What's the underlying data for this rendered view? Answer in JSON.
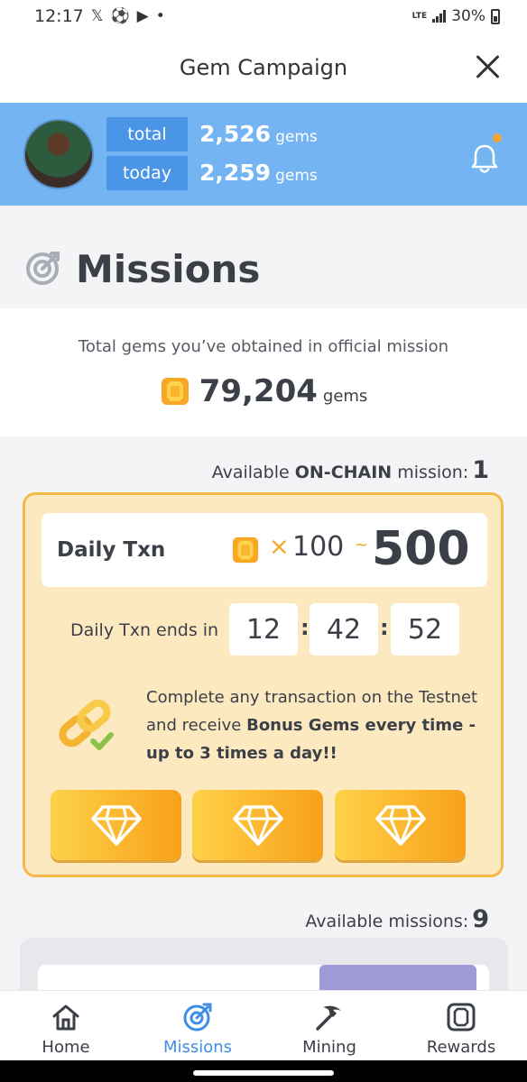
{
  "status_bar": {
    "time": "12:17",
    "network": "LTE",
    "battery": "30%"
  },
  "header": {
    "title": "Gem Campaign"
  },
  "profile": {
    "total_label": "total",
    "total_value": "2,526",
    "today_label": "today",
    "today_value": "2,259",
    "unit": "gems"
  },
  "missions": {
    "title": "Missions",
    "official_label": "Total gems you’ve obtained in official mission",
    "official_value": "79,204",
    "official_unit": "gems"
  },
  "onchain": {
    "prefix": "Available ",
    "bold": "ON-CHAIN",
    "suffix": " mission:",
    "count": "1"
  },
  "daily_txn": {
    "title": "Daily Txn",
    "multiplier": "×",
    "min": "100",
    "tilde": "~",
    "max": "500",
    "ends_label": "Daily Txn ends in",
    "timer": {
      "hours": "12",
      "minutes": "42",
      "seconds": "52"
    },
    "desc_part1": "Complete any transaction on the Testnet and receive ",
    "desc_bold": "Bonus Gems every time - up to 3 times a day!!"
  },
  "available_missions": {
    "label": "Available missions:",
    "count": "9"
  },
  "nav": [
    {
      "label": "Home"
    },
    {
      "label": "Missions"
    },
    {
      "label": "Mining"
    },
    {
      "label": "Rewards"
    }
  ],
  "colors": {
    "accent": "#74b4f2",
    "tag": "#4b95e6",
    "gold": "#f5a524",
    "card_bg": "#fde9c0",
    "active_nav": "#3f8ee6"
  }
}
